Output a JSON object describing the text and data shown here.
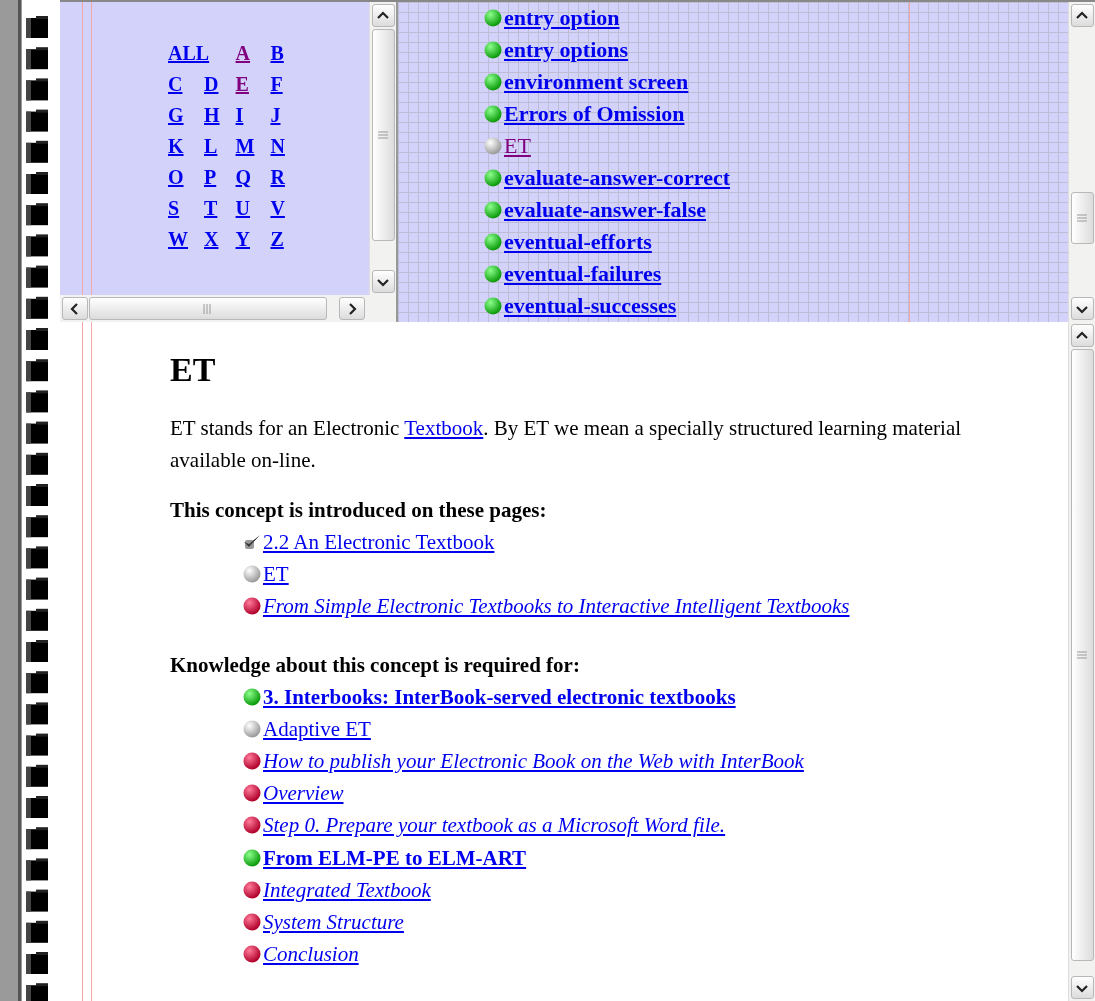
{
  "index_letters": [
    {
      "label": "ALL",
      "visited": false
    },
    {
      "label": "A",
      "visited": true
    },
    {
      "label": "B",
      "visited": false
    },
    {
      "label": "C",
      "visited": false
    },
    {
      "label": "D",
      "visited": false
    },
    {
      "label": "E",
      "visited": true
    },
    {
      "label": "F",
      "visited": false
    },
    {
      "label": "G",
      "visited": false
    },
    {
      "label": "H",
      "visited": false
    },
    {
      "label": "I",
      "visited": false
    },
    {
      "label": "J",
      "visited": false
    },
    {
      "label": "K",
      "visited": false
    },
    {
      "label": "L",
      "visited": false
    },
    {
      "label": "M",
      "visited": false
    },
    {
      "label": "N",
      "visited": false
    },
    {
      "label": "O",
      "visited": false
    },
    {
      "label": "P",
      "visited": false
    },
    {
      "label": "Q",
      "visited": false
    },
    {
      "label": "R",
      "visited": false
    },
    {
      "label": "S",
      "visited": false
    },
    {
      "label": "T",
      "visited": false
    },
    {
      "label": "U",
      "visited": false
    },
    {
      "label": "V",
      "visited": false
    },
    {
      "label": "W",
      "visited": false
    },
    {
      "label": "X",
      "visited": false
    },
    {
      "label": "Y",
      "visited": false
    },
    {
      "label": "Z",
      "visited": false
    }
  ],
  "concept_list": [
    {
      "label": "entry option",
      "kind": "green",
      "visited": false
    },
    {
      "label": "entry options",
      "kind": "green",
      "visited": false
    },
    {
      "label": "environment screen",
      "kind": "green",
      "visited": false
    },
    {
      "label": "Errors of Omission",
      "kind": "green",
      "visited": false
    },
    {
      "label": "ET",
      "kind": "white",
      "visited": true
    },
    {
      "label": "evaluate-answer-correct",
      "kind": "green",
      "visited": false
    },
    {
      "label": "evaluate-answer-false",
      "kind": "green",
      "visited": false
    },
    {
      "label": "eventual-efforts",
      "kind": "green",
      "visited": false
    },
    {
      "label": "eventual-failures",
      "kind": "green",
      "visited": false
    },
    {
      "label": "eventual-successes",
      "kind": "green",
      "visited": false
    }
  ],
  "article": {
    "title": "ET",
    "intro_before": "ET stands for an Electronic ",
    "intro_link": "Textbook",
    "intro_after": ". By ET we mean a specially structured learning material available on-line.",
    "sections": [
      {
        "heading": "This concept is introduced on these pages:",
        "links": [
          {
            "label": "2.2 An Electronic Textbook",
            "kind": "check"
          },
          {
            "label": "ET",
            "kind": "white"
          },
          {
            "label": "From Simple Electronic Textbooks to Interactive Intelligent Textbooks",
            "kind": "red"
          }
        ]
      },
      {
        "heading": "Knowledge about this concept is required for:",
        "links": [
          {
            "label": "3. Interbooks: InterBook-served electronic textbooks",
            "kind": "green"
          },
          {
            "label": "Adaptive ET",
            "kind": "white"
          },
          {
            "label": "How to publish your Electronic Book on the Web with InterBook",
            "kind": "red"
          },
          {
            "label": "Overview",
            "kind": "red"
          },
          {
            "label": "Step 0. Prepare your textbook as a Microsoft Word file.",
            "kind": "red"
          },
          {
            "label": "From ELM-PE to ELM-ART",
            "kind": "green"
          },
          {
            "label": "Integrated Textbook",
            "kind": "red"
          },
          {
            "label": "System Structure",
            "kind": "red"
          },
          {
            "label": "Conclusion",
            "kind": "red"
          }
        ]
      }
    ]
  }
}
